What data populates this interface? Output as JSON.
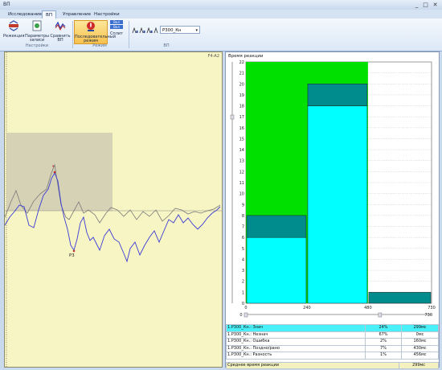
{
  "window": {
    "title": "ВП",
    "controls": [
      "_",
      "□",
      "✕"
    ]
  },
  "tabs": [
    "Исследование",
    "ВП",
    "Управление",
    "Настройки"
  ],
  "ribbon": {
    "groups": [
      {
        "label": "Настройки",
        "buttons": [
          "Режекция",
          "Параметры записи",
          "Сравнить ВП"
        ]
      },
      {
        "label": "Режим",
        "buttons": [
          "Последовательный режим",
          "Сплит"
        ]
      },
      {
        "label": "ВП",
        "buttons": []
      }
    ],
    "split_icon_labels": [
      "Вкл",
      "Вкл"
    ],
    "select_value": "P300_Кн"
  },
  "eeg": {
    "lead": "F4-A2",
    "markers": [
      "P3"
    ],
    "colors": {
      "trace_blue": "#3a3ad6",
      "trace_grey": "#7a7a7a",
      "area": "#cfcbb4"
    }
  },
  "reaction": {
    "title": "Время реакции",
    "y_axis_top": "22",
    "x_axis_end": "730",
    "results": [
      {
        "name": "1.P300_Кн.: Знач",
        "pct": "24%",
        "time": "299мс"
      },
      {
        "name": "1.P300_Кн.: Незнач",
        "pct": "67%",
        "time": "0мс"
      },
      {
        "name": "1.P300_Кн.: Ошибка",
        "pct": "2%",
        "time": "160мс"
      },
      {
        "name": "1.P300_Кн.: Поздно/рано",
        "pct": "7%",
        "time": "430мс"
      },
      {
        "name": "1.P300_Кн.: Разность",
        "pct": "1%",
        "time": "456мс"
      }
    ],
    "average_label": "Среднее время реакции",
    "average_value": "299мс"
  },
  "chart_data": {
    "type": "bar",
    "title": "Время реакции",
    "x": [
      0,
      240,
      480,
      730
    ],
    "x_ticks": [
      "0",
      "240",
      "480",
      "730"
    ],
    "y_ticks": [
      "0",
      "1",
      "2",
      "3",
      "4",
      "5",
      "6",
      "7",
      "8",
      "9",
      "10",
      "11",
      "12",
      "13",
      "14",
      "15",
      "16",
      "17",
      "18",
      "19",
      "20",
      "21",
      "22"
    ],
    "ylim": [
      0,
      22
    ],
    "bins": [
      {
        "x0": 0,
        "x1": 240,
        "cyan": 6,
        "teal": 2
      },
      {
        "x0": 240,
        "x1": 480,
        "cyan": 18,
        "teal": 2
      },
      {
        "x0": 480,
        "x1": 730,
        "cyan": 0,
        "teal": 1
      }
    ],
    "green_region": [
      0,
      480
    ],
    "colors": {
      "cyan": "#00ffff",
      "teal": "#008c8c",
      "green": "#00e000"
    }
  }
}
